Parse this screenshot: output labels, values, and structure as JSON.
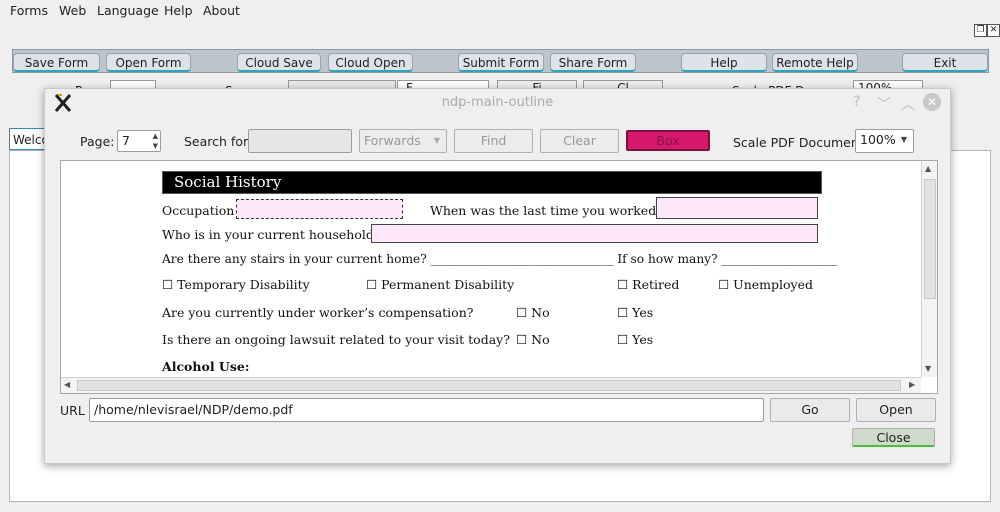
{
  "menu": [
    "Forms",
    "Web",
    "Language",
    "Help",
    "About"
  ],
  "toolbar": [
    "Save Form",
    "Open Form",
    "Cloud Save",
    "Cloud Open",
    "Submit Form",
    "Share Form",
    "Help",
    "Remote Help",
    "Exit"
  ],
  "background": {
    "tab_label": "Welco",
    "partial_row": [
      "P",
      "S",
      "F",
      "Fi",
      "Cl",
      "Scale PDF D",
      "100%"
    ]
  },
  "dialog": {
    "title": "ndp-main-outline",
    "page_label": "Page:",
    "page_value": "7",
    "search_label": "Search for:",
    "search_value": "",
    "direction": "Forwards",
    "find": "Find",
    "clear": "Clear",
    "box": "Box",
    "scale_label": "Scale PDF Document:",
    "scale_value": "100%",
    "url_label": "URL",
    "url_value": "/home/nlevisrael/NDP/demo.pdf",
    "go": "Go",
    "open": "Open",
    "close": "Close",
    "colors": {
      "box_button": "#d6196c",
      "header_bar": "#000000",
      "field_fill": "#fde7fb"
    }
  },
  "pdf": {
    "section_title": "Social History",
    "occupation": "Occupation:",
    "last_worked": "When was the last time you worked?",
    "household": "Who is in your current household?",
    "stairs": "Are there any stairs in your current home? ______________________________ If so how many? ___________________",
    "options": [
      "☐ Temporary Disability",
      "☐ Permanent Disability",
      "☐ Retired",
      "☐ Unemployed"
    ],
    "workers_comp": "Are you currently under worker’s compensation?",
    "lawsuit": "Is there an ongoing lawsuit related to your visit today?",
    "no": "☐ No",
    "yes": "☐ Yes",
    "alcohol": "Alcohol Use:"
  }
}
